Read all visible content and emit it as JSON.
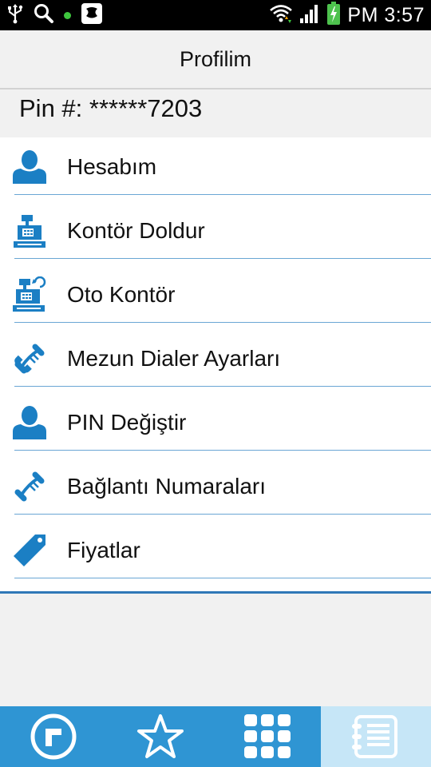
{
  "status_bar": {
    "time": "PM 3:57",
    "icons": [
      "usb-icon",
      "search-icon",
      "notification-dot-icon",
      "app-notification-icon",
      "wifi-icon",
      "signal-icon",
      "battery-charging-icon"
    ]
  },
  "header": {
    "title": "Profilim"
  },
  "pin": {
    "label": "Pin #: ******7203"
  },
  "menu": {
    "items": [
      {
        "label": "Hesabım",
        "icon": "user-icon"
      },
      {
        "label": "Kontör Doldur",
        "icon": "cash-register-icon"
      },
      {
        "label": "Oto Kontör",
        "icon": "auto-cash-register-icon"
      },
      {
        "label": "Mezun Dialer Ayarları",
        "icon": "phone-icon"
      },
      {
        "label": "PIN Değiştir",
        "icon": "user-icon"
      },
      {
        "label": "Bağlantı Numaraları",
        "icon": "phone-icon"
      },
      {
        "label": "Fiyatlar",
        "icon": "price-tag-icon"
      }
    ]
  },
  "bottom_nav": {
    "tabs": [
      "dialer-logo-icon",
      "star-icon",
      "grid-icon",
      "contacts-list-icon"
    ],
    "active_tab": "contacts-list-icon"
  },
  "colors": {
    "accent": "#2f95d3",
    "icon_blue": "#1b7fc4",
    "active_tab_bg": "#c6e6f7"
  }
}
